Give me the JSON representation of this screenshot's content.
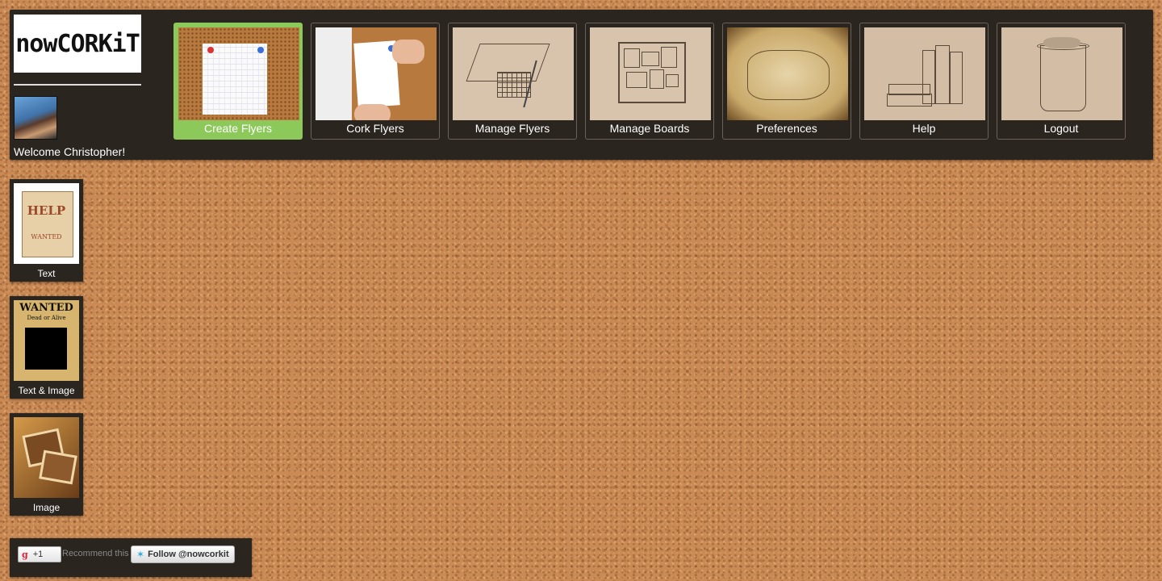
{
  "app": {
    "logo_text": "nowCORKiT",
    "welcome": "Welcome Christopher!"
  },
  "nav": {
    "items": [
      {
        "label": "Create Flyers",
        "active": true
      },
      {
        "label": "Cork Flyers",
        "active": false
      },
      {
        "label": "Manage Flyers",
        "active": false
      },
      {
        "label": "Manage Boards",
        "active": false
      },
      {
        "label": "Preferences",
        "active": false
      },
      {
        "label": "Help",
        "active": false
      },
      {
        "label": "Logout",
        "active": false
      }
    ]
  },
  "templates": {
    "items": [
      {
        "label": "Text",
        "thumb_text_1": "HELP",
        "thumb_text_2": "WANTED"
      },
      {
        "label": "Text & Image",
        "thumb_text_1": "WANTED",
        "thumb_text_2": "Dead or Alive"
      },
      {
        "label": "Image"
      }
    ]
  },
  "social": {
    "gplus_label": "+1",
    "gplus_icon": "g",
    "recommend": "Recommend this",
    "follow": "Follow @nowcorkit"
  },
  "colors": {
    "bar_bg": "#2b2520",
    "active": "#8cc85a",
    "cork": "#c98a55"
  }
}
